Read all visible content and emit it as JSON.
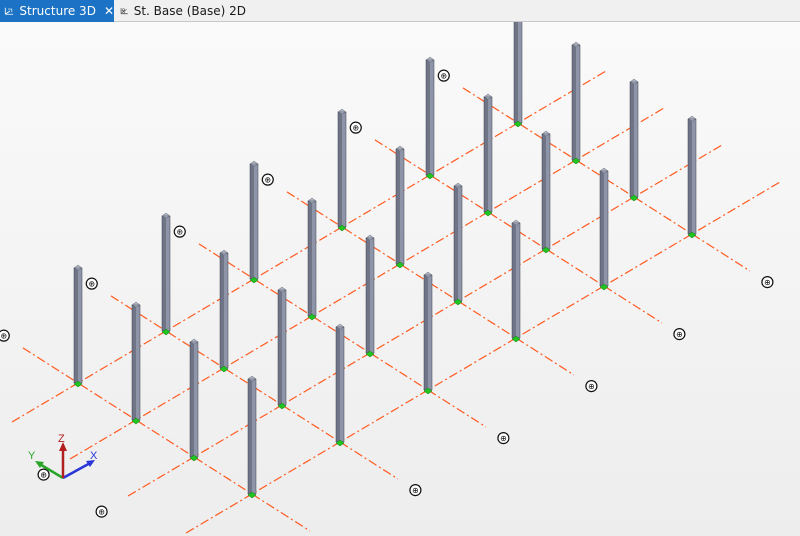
{
  "tabs": [
    {
      "label": "Structure 3D",
      "active": true,
      "close_glyph": "✕",
      "icon": "structure-3d-icon"
    },
    {
      "label": "St. Base (Base) 2D",
      "active": false,
      "icon": "plan-2d-icon"
    }
  ],
  "axes_triad": {
    "x": "X",
    "y": "Y",
    "z": "Z"
  },
  "grid_bubble_glyph": "⊕",
  "colors": {
    "active_tab": "#1c72c4",
    "grid_line": "#ff5a1f",
    "column_front": "#8f95a8",
    "column_side": "#6f7487",
    "support": "#21c421",
    "axis_x": "#2a36d8",
    "axis_y": "#2aa52a",
    "axis_z": "#b21f1f"
  }
}
